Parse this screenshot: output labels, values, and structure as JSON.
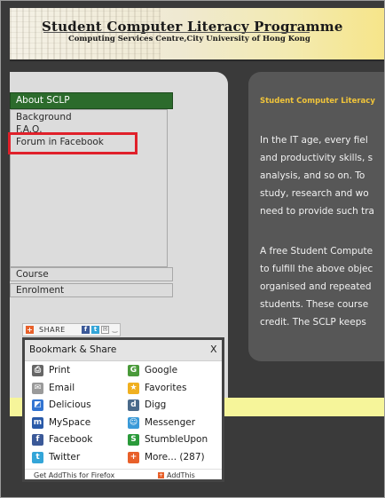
{
  "header": {
    "title": "Student Computer Literacy Programme",
    "subtitle": "Computing Services Centre,City University of Hong Kong"
  },
  "sidebar": {
    "section_title": "About SCLP",
    "items": [
      "Background",
      "F.A.Q.",
      "Forum in Facebook"
    ],
    "sections": [
      "Course",
      "Enrolment"
    ]
  },
  "main": {
    "title": "Student Computer Literacy",
    "paragraph1": [
      "In the IT age, every fiel",
      "and productivity skills, s",
      "analysis, and so on. To",
      "study, research and wo",
      "need to provide such tra"
    ],
    "paragraph2": [
      "A free Student Compute",
      "to fulfill the above objec",
      "organised and repeated",
      "students. These course",
      "credit. The SCLP keeps"
    ]
  },
  "share": {
    "label": "SHARE"
  },
  "bookmark_popup": {
    "title": "Bookmark & Share",
    "close_label": "X",
    "left_column": [
      {
        "label": "Print",
        "icon": "printer-icon",
        "glyph": "⎙",
        "color": "#666666"
      },
      {
        "label": "Email",
        "icon": "email-icon",
        "glyph": "✉",
        "color": "#9a9a9a"
      },
      {
        "label": "Delicious",
        "icon": "delicious-icon",
        "glyph": "◩",
        "color": "#3274d1"
      },
      {
        "label": "MySpace",
        "icon": "myspace-icon",
        "glyph": "m",
        "color": "#2a5aa8"
      },
      {
        "label": "Facebook",
        "icon": "facebook-icon",
        "glyph": "f",
        "color": "#3b5998"
      },
      {
        "label": "Twitter",
        "icon": "twitter-icon",
        "glyph": "t",
        "color": "#33a5d8"
      }
    ],
    "right_column": [
      {
        "label": "Google",
        "icon": "google-icon",
        "glyph": "G",
        "color": "#4a9a3a"
      },
      {
        "label": "Favorites",
        "icon": "favorites-star-icon",
        "glyph": "★",
        "color": "#f0b020"
      },
      {
        "label": "Digg",
        "icon": "digg-icon",
        "glyph": "d",
        "color": "#4a6a8a"
      },
      {
        "label": "Messenger",
        "icon": "messenger-icon",
        "glyph": "☺",
        "color": "#3a9ad8"
      },
      {
        "label": "StumbleUpon",
        "icon": "stumbleupon-icon",
        "glyph": "S",
        "color": "#2a9a3a"
      },
      {
        "label": "More... (287)",
        "icon": "more-plus-icon",
        "glyph": "+",
        "color": "#e8602a"
      }
    ],
    "footer_left": "Get AddThis for Firefox",
    "footer_right": "AddThis"
  },
  "colors": {
    "menu_head": "#2c6b2c",
    "highlight": "#e0202a",
    "accent_title": "#f0c43a",
    "strip": "#f6f59a"
  }
}
